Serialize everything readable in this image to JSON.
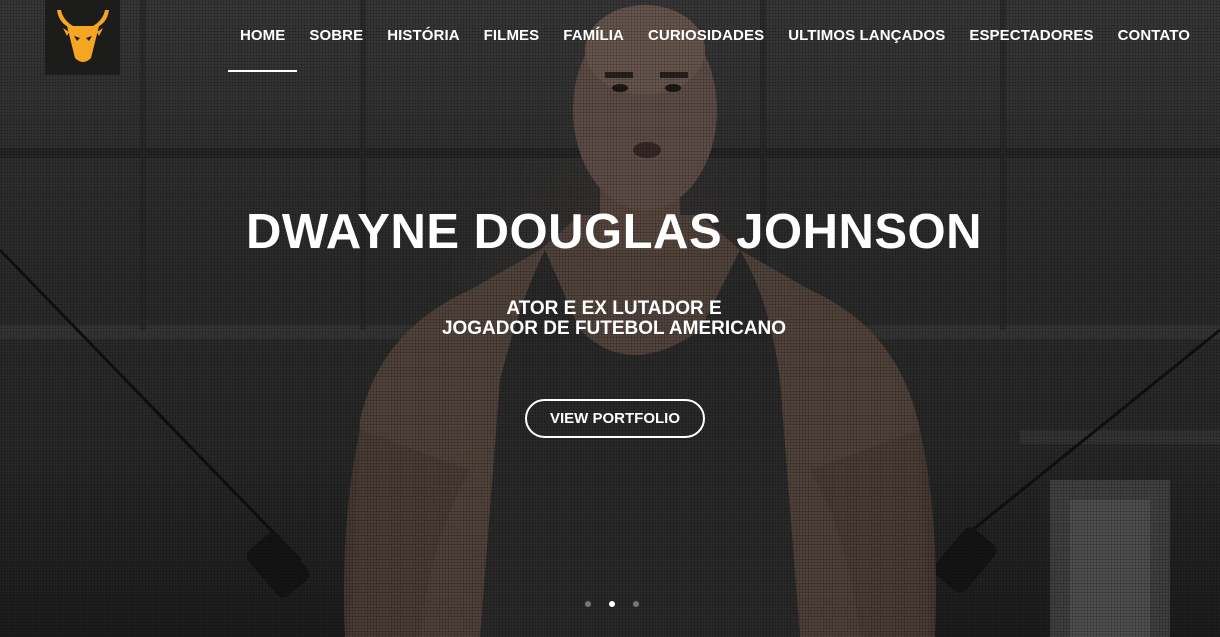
{
  "brand": {
    "logo_icon": "bull-head-icon",
    "logo_color": "#f5a623"
  },
  "nav": {
    "items": [
      {
        "label": "HOME",
        "active": true
      },
      {
        "label": "SOBRE",
        "active": false
      },
      {
        "label": "HISTÓRIA",
        "active": false
      },
      {
        "label": "FILMES",
        "active": false
      },
      {
        "label": "FAMÍLIA",
        "active": false
      },
      {
        "label": "CURIOSIDADES",
        "active": false
      },
      {
        "label": "ULTIMOS LANÇADOS",
        "active": false
      },
      {
        "label": "ESPECTADORES",
        "active": false
      },
      {
        "label": "CONTATO",
        "active": false
      }
    ]
  },
  "hero": {
    "title": "DWAYNE DOUGLAS JOHNSON",
    "subtitle_line1": "ATOR E EX LUTADOR E",
    "subtitle_line2": "JOGADOR DE FUTEBOL AMERICANO",
    "cta_label": "VIEW PORTFOLIO",
    "background_icon": "gym-portrait-photo"
  },
  "carousel": {
    "slide_count": 3,
    "active_index": 1
  },
  "colors": {
    "text": "#ffffff",
    "accent": "#f5a623",
    "indicator_inactive": "#777777"
  }
}
